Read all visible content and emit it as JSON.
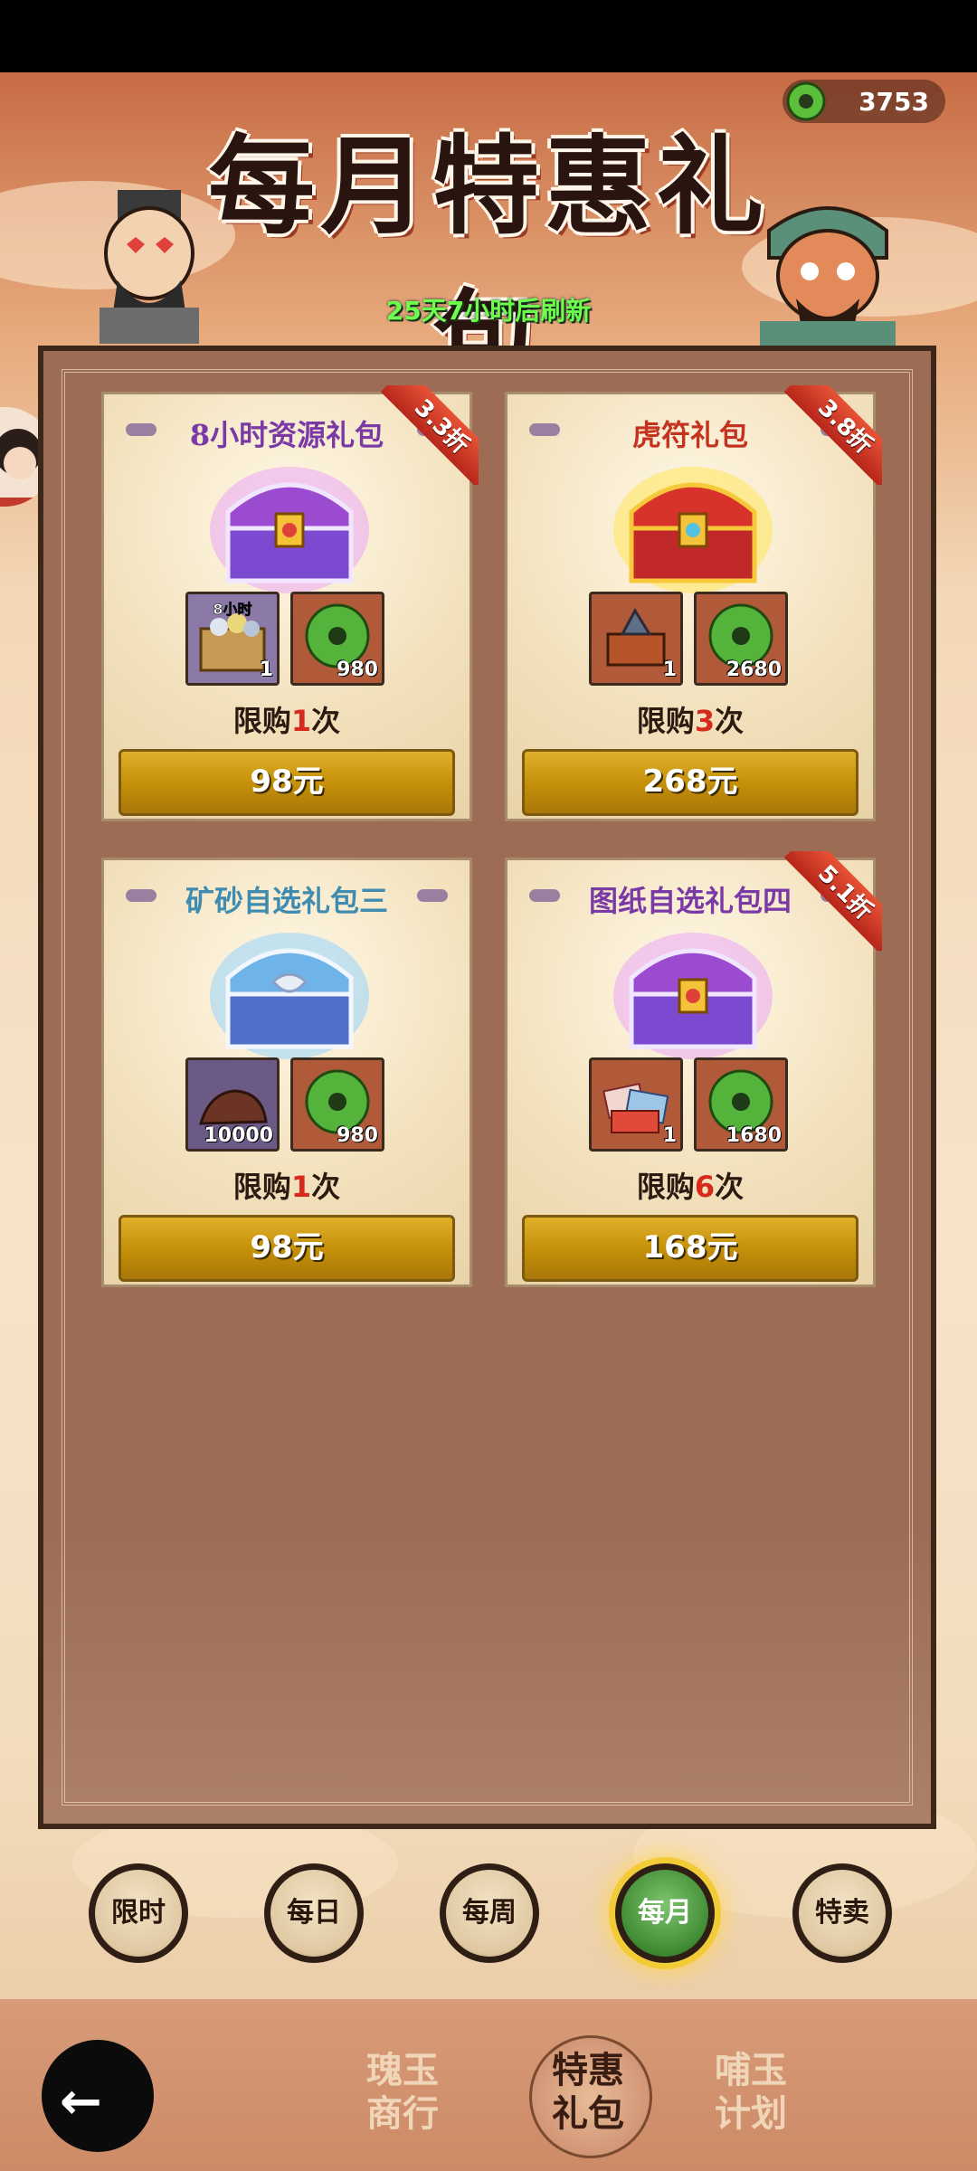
{
  "header": {
    "currency_amount": "3753",
    "title": "每月特惠礼包",
    "refresh_text": "25天7小时后刷新"
  },
  "packs": [
    {
      "name": "8小时资源礼包",
      "name_color": "#7a3aa6",
      "discount": "3.3折",
      "items": [
        {
          "icon": "resource-crate-icon",
          "label": "8小时",
          "count": "1"
        },
        {
          "icon": "jade-coin-icon",
          "count": "980"
        }
      ],
      "limit_prefix": "限购",
      "limit_num": "1",
      "limit_suffix": "次",
      "price": "98元",
      "chest": "purple"
    },
    {
      "name": "虎符礼包",
      "name_color": "#c4331f",
      "discount": "3.8折",
      "items": [
        {
          "icon": "tiger-tally-icon",
          "count": "1"
        },
        {
          "icon": "jade-coin-icon",
          "count": "2680"
        }
      ],
      "limit_prefix": "限购",
      "limit_num": "3",
      "limit_suffix": "次",
      "price": "268元",
      "chest": "gold"
    },
    {
      "name": "矿砂自选礼包三",
      "name_color": "#3f8cb0",
      "discount": "",
      "items": [
        {
          "icon": "ore-sand-icon",
          "count": "10000"
        },
        {
          "icon": "jade-coin-icon",
          "count": "980"
        }
      ],
      "limit_prefix": "限购",
      "limit_num": "1",
      "limit_suffix": "次",
      "price": "98元",
      "chest": "blue"
    },
    {
      "name": "图纸自选礼包四",
      "name_color": "#7a3aa6",
      "discount": "5.1折",
      "items": [
        {
          "icon": "blueprint-bundle-icon",
          "count": "1"
        },
        {
          "icon": "jade-coin-icon",
          "count": "1680"
        }
      ],
      "limit_prefix": "限购",
      "limit_num": "6",
      "limit_suffix": "次",
      "price": "168元",
      "chest": "purple"
    }
  ],
  "tabs": [
    "限时",
    "每日",
    "每周",
    "每月",
    "特卖"
  ],
  "active_tab": "每月",
  "bottom_nav": {
    "item1_line1": "瑰玉",
    "item1_line2": "商行",
    "item2_line1": "特惠",
    "item2_line2": "礼包",
    "item3_line1": "哺玉",
    "item3_line2": "计划"
  },
  "colors": {
    "accent_red": "#d62b1c",
    "button_gold": "#c38e08",
    "active_tab_green": "#3f8b33"
  }
}
